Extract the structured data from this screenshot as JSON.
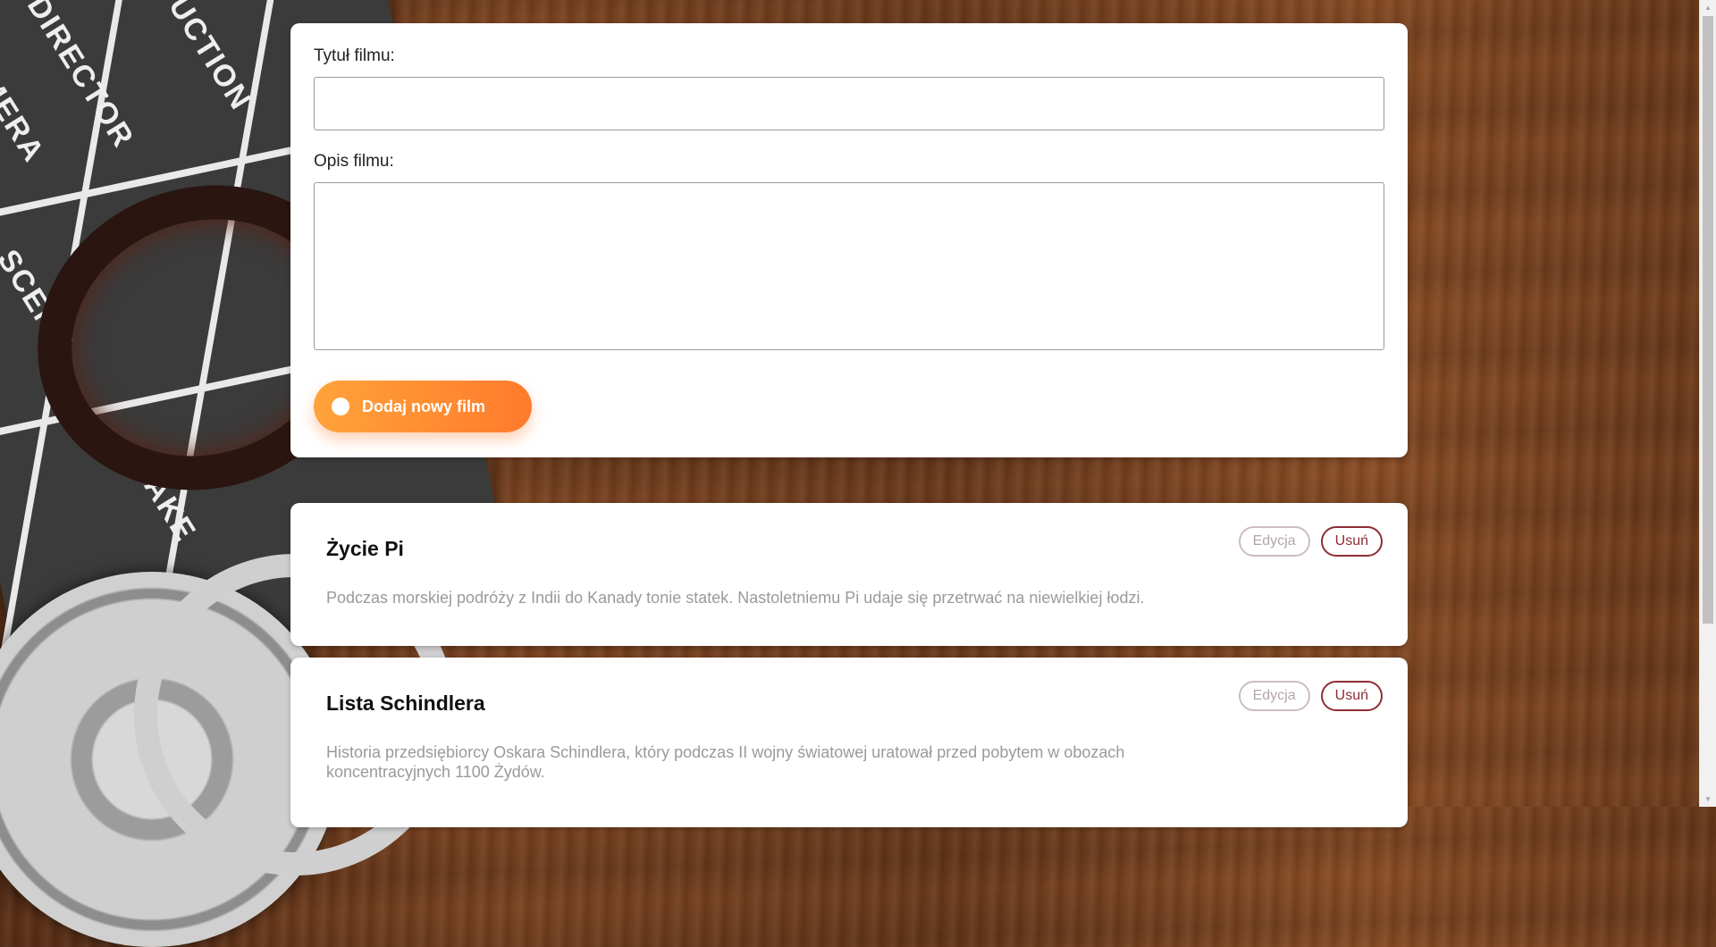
{
  "form": {
    "title_label": "Tytuł filmu:",
    "title_value": "",
    "description_label": "Opis filmu:",
    "description_value": "",
    "add_button_label": "Dodaj nowy film"
  },
  "movies": [
    {
      "title": "Życie Pi",
      "description": "Podczas morskiej podróży z Indii do Kanady tonie statek. Nastoletniemu Pi udaje się przetrwać na niewielkiej łodzi.",
      "edit_label": "Edycja",
      "delete_label": "Usuń"
    },
    {
      "title": "Lista Schindlera",
      "description": "Historia przedsiębiorcy Oskara Schindlera, który podczas II wojny światowej uratował przed pobytem w obozach koncentracyjnych 1100 Żydów.",
      "edit_label": "Edycja",
      "delete_label": "Usuń"
    }
  ],
  "background": {
    "clapperboard_words": [
      "CAMERA",
      "DIRECTOR",
      "PRODUCTION",
      "SCENE",
      "TAKE"
    ]
  },
  "colors": {
    "accent_gradient_start": "#ffa33a",
    "accent_gradient_end": "#ff7a2c",
    "delete_color": "#8e2d33",
    "edit_color": "#cdbdbd"
  }
}
